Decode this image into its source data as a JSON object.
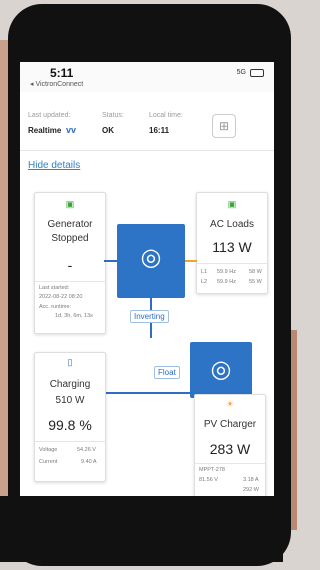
{
  "statusbar": {
    "time": "5:11",
    "back_label": "◂ VictronConnect",
    "signal": "5G"
  },
  "info": {
    "last_updated_label": "Last updated:",
    "last_updated_value": "Realtime",
    "status_label": "Status:",
    "status_value": "OK",
    "local_time_label": "Local time:",
    "local_time_value": "16:11"
  },
  "hide_details": "Hide details",
  "generator": {
    "title_line1": "Generator",
    "title_line2": "Stopped",
    "value": "-",
    "last_started_label": "Last started:",
    "last_started_value": "2022-08-22 08:20",
    "acc_runtime_label": "Acc. runtime:",
    "acc_runtime_value": "1d, 3h, 6m, 13s"
  },
  "ac_loads": {
    "title": "AC Loads",
    "value": "113 W",
    "rows": [
      {
        "phase": "L1",
        "freq": "59.9 Hz",
        "power": "58 W"
      },
      {
        "phase": "L2",
        "freq": "59.9 Hz",
        "power": "55 W"
      }
    ]
  },
  "inverter_state": "Inverting",
  "charger_state": "Float",
  "battery": {
    "title": "Charging",
    "power": "510 W",
    "soc": "99.8 %",
    "voltage_label": "Voltage",
    "voltage_value": "54.26 V",
    "current_label": "Current",
    "current_value": "9.40 A"
  },
  "pv": {
    "title": "PV Charger",
    "value": "283 W",
    "name": "MPPT-278",
    "row1_left": "81.56 V",
    "row1_right": "3.18 A",
    "row2_right": "292 W"
  }
}
